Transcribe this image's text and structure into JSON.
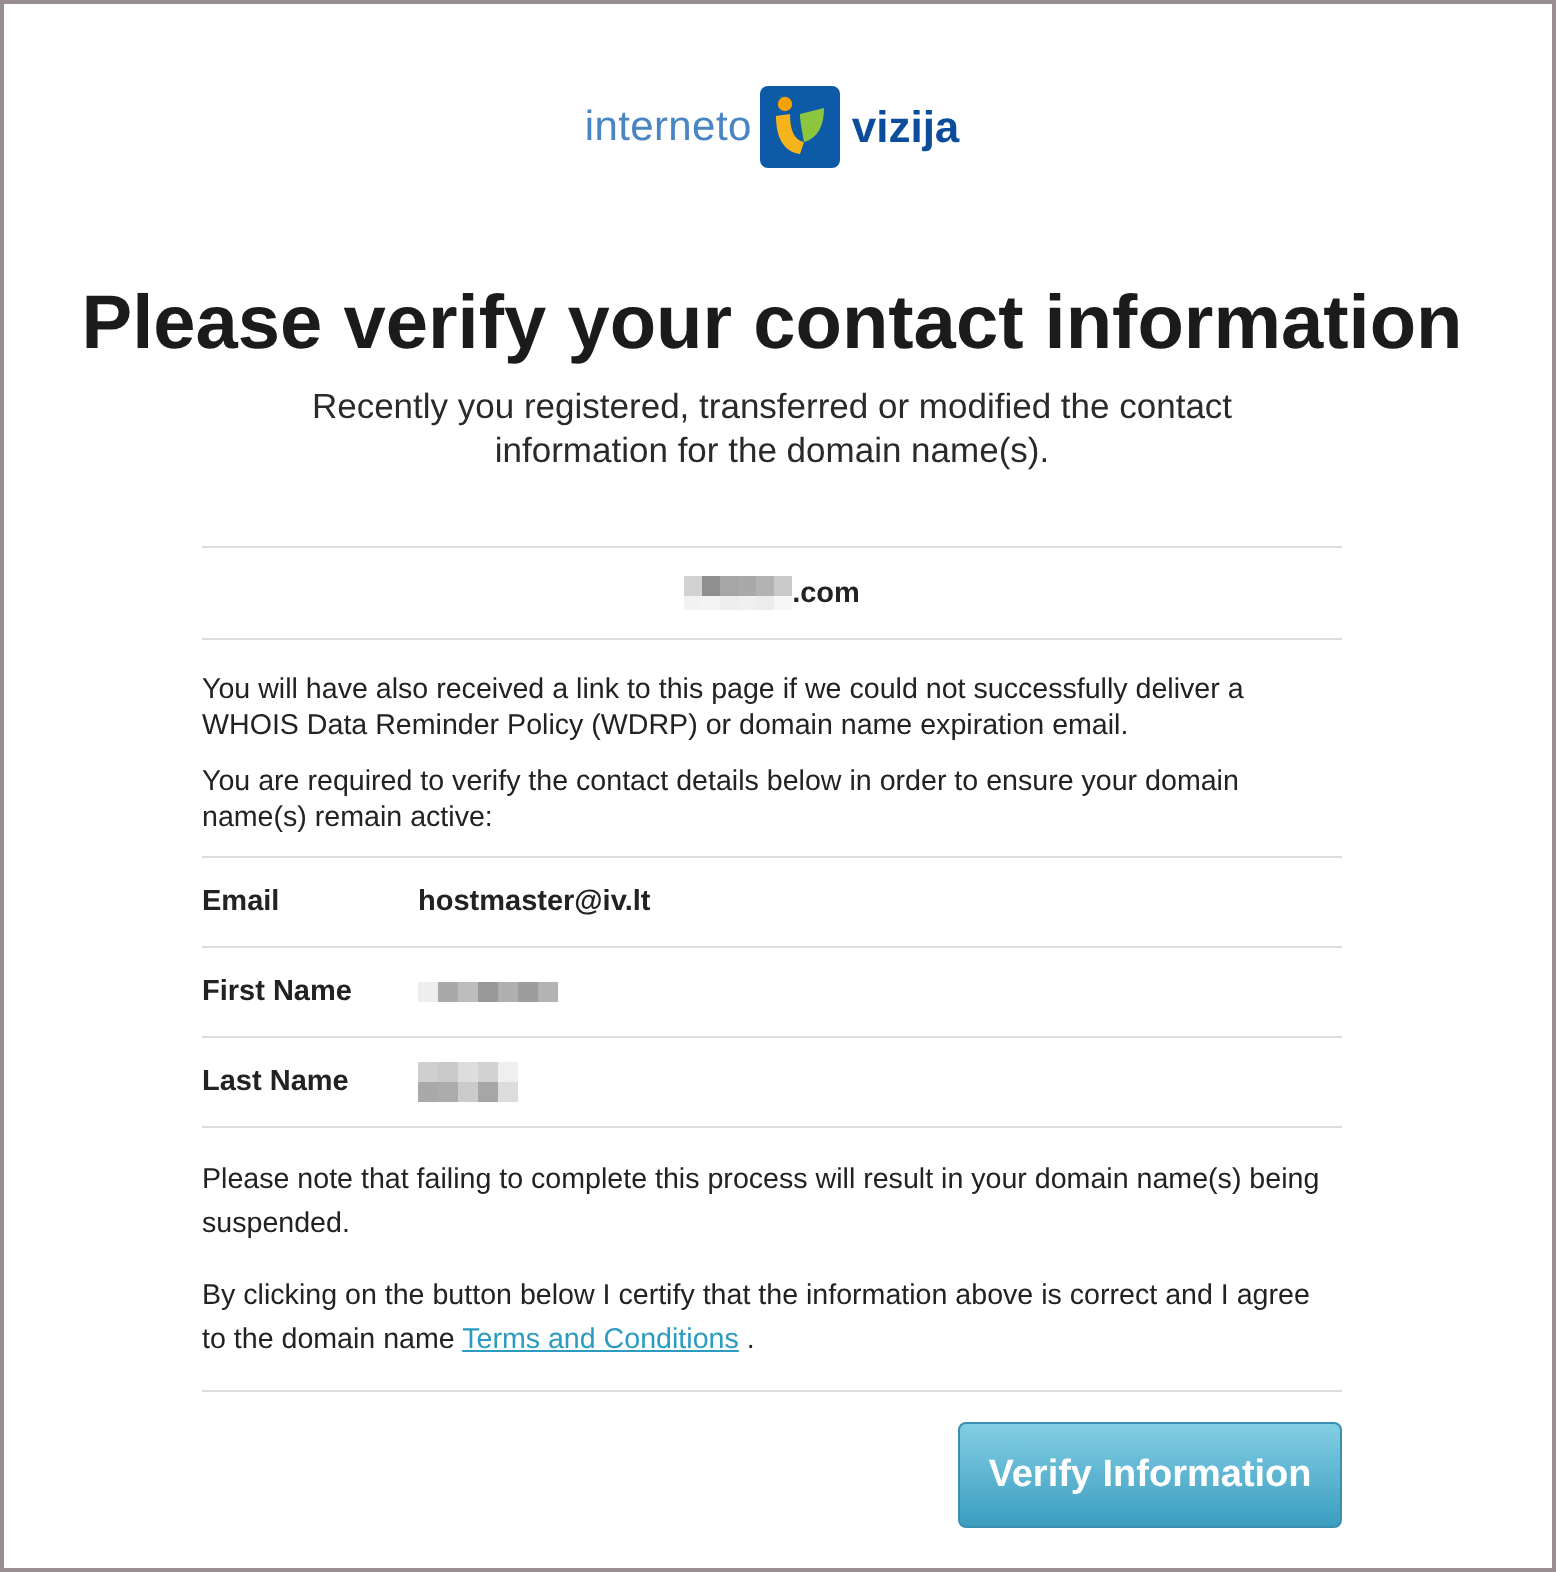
{
  "logo": {
    "text_left": "interneto",
    "text_right": "vizija"
  },
  "heading": "Please verify your contact information",
  "subtitle": "Recently you registered, transferred or modified the contact information for the domain name(s).",
  "domain": {
    "redacted": true,
    "suffix": ".com"
  },
  "intro_paragraphs": [
    "You will have also received a link to this page if we could not successfully deliver a WHOIS Data Reminder Policy (WDRP) or domain name expiration email.",
    "You are required to verify the contact details below in order to ensure your domain name(s) remain active:"
  ],
  "contact_rows": [
    {
      "label": "Email",
      "kind": "text",
      "value": "hostmaster@iv.lt"
    },
    {
      "label": "First Name",
      "kind": "redacted"
    },
    {
      "label": "Last Name",
      "kind": "redacted"
    }
  ],
  "notice": "Please note that failing to complete this process will result in your domain name(s) being suspended.",
  "agreement": {
    "text_before": "By clicking on the button below I certify that the information above is correct and I agree to the domain name",
    "link": "Terms and Conditions",
    "text_after": "."
  },
  "button": "Verify Information"
}
